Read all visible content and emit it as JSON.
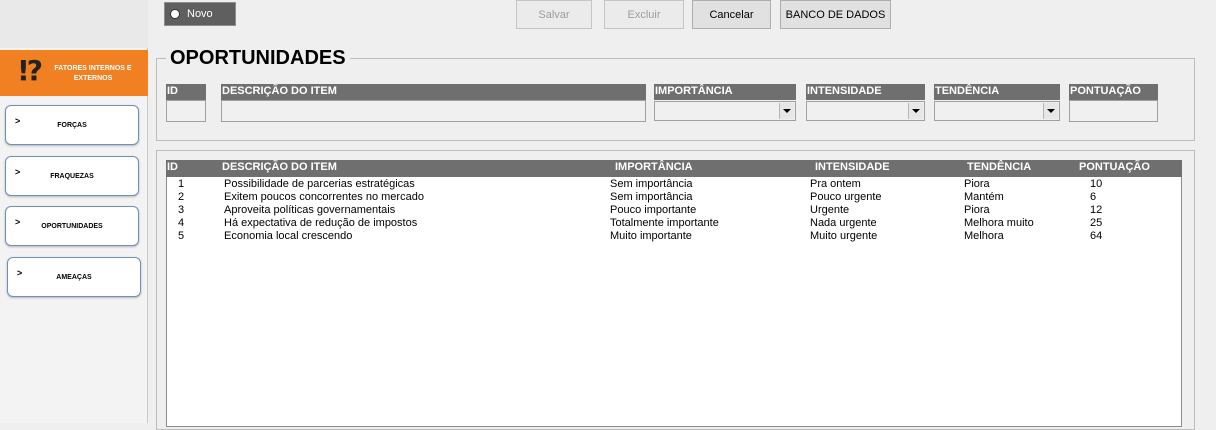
{
  "sidebar": {
    "brand_icon": "!?",
    "brand_title": "FATORES INTERNOS E EXTERNOS",
    "arrow": ">",
    "items": [
      {
        "label": "FORÇAS"
      },
      {
        "label": "FRAQUEZAS"
      },
      {
        "label": "OPORTUNIDADES"
      },
      {
        "label": "AMEAÇAS"
      }
    ]
  },
  "toolbar": {
    "novo_label": "Novo",
    "salvar_label": "Salvar",
    "excluir_label": "Excluir",
    "cancelar_label": "Cancelar",
    "banco_label": "BANCO DE DADOS"
  },
  "form": {
    "title": "OPORTUNIDADES",
    "headers": {
      "id": "ID",
      "descricao": "DESCRIÇÃO DO ITEM",
      "importancia": "IMPORTÂNCIA",
      "intensidade": "INTENSIDADE",
      "tendencia": "TENDÊNCIA",
      "pontuacao": "PONTUAÇÃO"
    }
  },
  "list": {
    "headers": {
      "id": "ID",
      "descricao": "DESCRIÇÃO DO ITEM",
      "importancia": "IMPORTÂNCIA",
      "intensidade": "INTENSIDADE",
      "tendencia": "TENDÊNCIA",
      "pontuacao": "PONTUAÇÃO"
    },
    "rows": [
      {
        "id": "1",
        "descricao": "Possibilidade de parcerias estratégicas",
        "importancia": "Sem importância",
        "intensidade": "Pra ontem",
        "tendencia": "Piora",
        "pontuacao": "10"
      },
      {
        "id": "2",
        "descricao": "Exitem poucos concorrentes no mercado",
        "importancia": "Sem importância",
        "intensidade": "Pouco urgente",
        "tendencia": "Mantém",
        "pontuacao": "6"
      },
      {
        "id": "3",
        "descricao": "Aproveita políticas governamentais",
        "importancia": "Pouco importante",
        "intensidade": "Urgente",
        "tendencia": "Piora",
        "pontuacao": "12"
      },
      {
        "id": "4",
        "descricao": "Há expectativa de redução de impostos",
        "importancia": "Totalmente importante",
        "intensidade": "Nada urgente",
        "tendencia": "Melhora muito",
        "pontuacao": "25"
      },
      {
        "id": "5",
        "descricao": "Economia local crescendo",
        "importancia": "Muito importante",
        "intensidade": "Muito urgente",
        "tendencia": "Melhora",
        "pontuacao": "64"
      }
    ]
  }
}
